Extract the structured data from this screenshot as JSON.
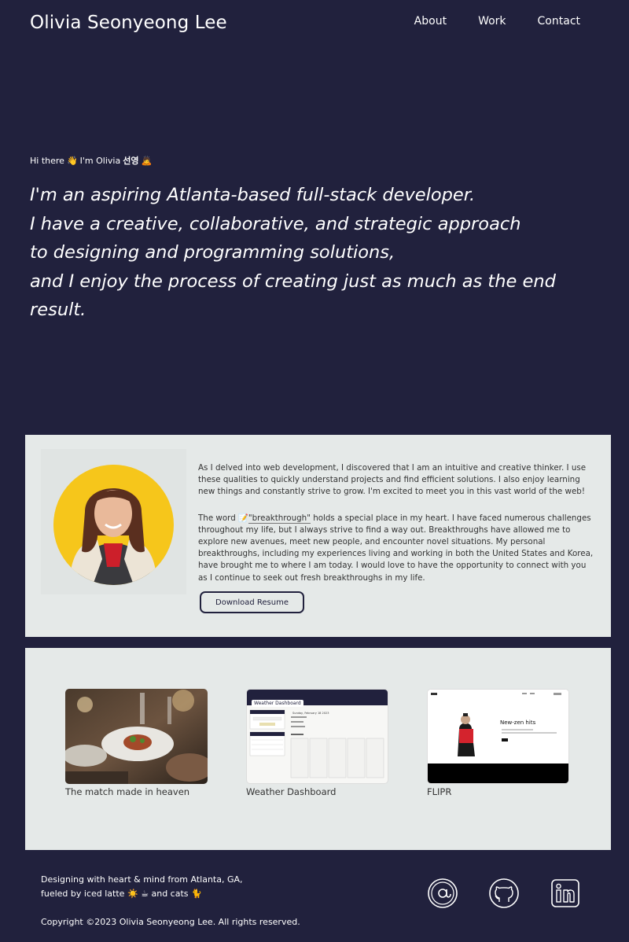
{
  "header": {
    "title": "Olivia Seonyeong Lee",
    "nav": [
      "About",
      "Work",
      "Contact"
    ]
  },
  "hero": {
    "greeting_prefix": "Hi there",
    "greeting_mid": "I'm Olivia",
    "greeting_name": "선영",
    "lines": [
      "I'm an aspiring Atlanta-based full-stack developer.",
      "I have a creative, collaborative, and strategic approach",
      "to designing and programming solutions,",
      "and I enjoy the process of creating just as much as the end result."
    ]
  },
  "about": {
    "paragraph1": "As I delved into web development, I discovered that I am an intuitive and creative thinker. I use these qualities to quickly understand projects and find efficient solutions. I also enjoy learning new things and constantly strive to grow. I'm excited to meet you in this vast world of the web!",
    "p2_before": "The word ",
    "p2_highlight": "\"breakthrough\"",
    "p2_after": " holds a special place in my heart. I have faced numerous challenges throughout my life, but I always strive to find a way out. Breakthroughs have allowed me to explore new avenues, meet new people, and encounter novel situations. My personal breakthroughs, including my experiences living and working in both the United States and Korea, have brought me to where I am today. I would love to have the opportunity to connect with you as I continue to seek out fresh breakthroughs in my life.",
    "resume_label": "Download Resume"
  },
  "work": {
    "projects": [
      {
        "label": "The match made in heaven"
      },
      {
        "label": "Weather Dashboard",
        "thumb_title": "Weather Dashboard",
        "date": "Sunday, February 18 2023"
      },
      {
        "label": "FLIPR",
        "thumb_heading": "New-zen hits"
      }
    ]
  },
  "footer": {
    "tagline1": "Designing with heart & mind from Atlanta, GA,",
    "tagline2": "fueled by iced latte ☀️ ☕ and cats 🐈",
    "copyright": "Copyright ©2023 Olivia Seonyeong Lee. All rights reserved."
  },
  "icons": {
    "email": "at-sign-icon",
    "github": "github-icon",
    "linkedin": "linkedin-icon"
  },
  "colors": {
    "background": "#21213d",
    "panel": "#e5e9e8",
    "photo_circle": "#f6c61b"
  }
}
